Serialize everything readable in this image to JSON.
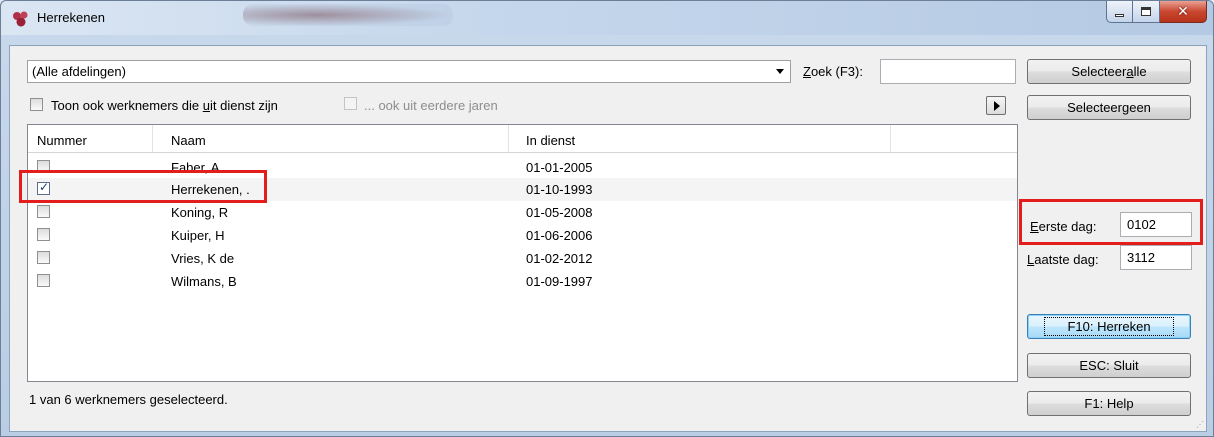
{
  "window": {
    "title": "Herrekenen",
    "blurred_title": "Loon Verdieg"
  },
  "filter": {
    "department": "(Alle afdelingen)",
    "search_label_u": "Z",
    "search_label_rest": "oek (F3):",
    "search_value": ""
  },
  "options": {
    "show_out_of_service_a": "Toon ook werknemers die ",
    "show_out_of_service_u": "u",
    "show_out_of_service_b": "it dienst zijn",
    "earlier_years": "... ook uit eerdere jaren"
  },
  "buttons": {
    "select_all_a": "Selecteer ",
    "select_all_u": "a",
    "select_all_b": "lle",
    "select_none_a": "Selecteer ",
    "select_none_u": "g",
    "select_none_b": "een",
    "recalc": "F10: Herreken",
    "close": "ESC: Sluit",
    "help": "F1: Help"
  },
  "table": {
    "columns": [
      "Nummer",
      "Naam",
      "In dienst"
    ],
    "rows": [
      {
        "checked": false,
        "name": "Faber, A",
        "date": "01-01-2005"
      },
      {
        "checked": true,
        "name": "Herrekenen, .",
        "date": "01-10-1993"
      },
      {
        "checked": false,
        "name": "Koning, R",
        "date": "01-05-2008"
      },
      {
        "checked": false,
        "name": "Kuiper, H",
        "date": "01-06-2006"
      },
      {
        "checked": false,
        "name": "Vries, K de",
        "date": "01-02-2012"
      },
      {
        "checked": false,
        "name": "Wilmans, B",
        "date": "01-09-1997"
      }
    ]
  },
  "period": {
    "first_day_u": "E",
    "first_day_rest": "erste dag:",
    "first_day_value": "0102",
    "last_day_u": "L",
    "last_day_rest": "aatste dag:",
    "last_day_value": "3112"
  },
  "status": "1 van 6 werknemers geselecteerd.",
  "colors": {
    "highlight": "#e31c1c",
    "title_bar": "#c5d7ec",
    "close_button": "#c9472f"
  }
}
